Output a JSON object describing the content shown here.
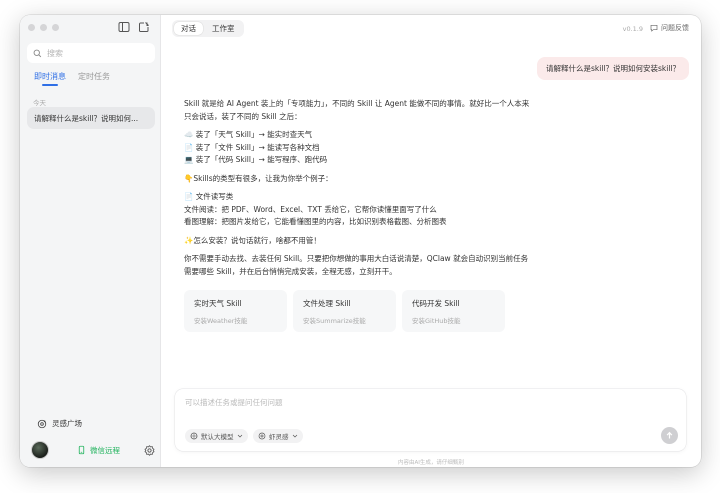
{
  "sidebar": {
    "search_placeholder": "搜索",
    "tabs": [
      "即时消息",
      "定时任务"
    ],
    "day_label": "今天",
    "conversation": "请解释什么是skill？说明如何...",
    "plaza_label": "灵感广场",
    "wechat_label": "微信远程"
  },
  "topbar": {
    "tabs": [
      "对话",
      "工作室"
    ],
    "version": "v0.1.9",
    "feedback_label": "问题反馈"
  },
  "chat": {
    "user_message": "请解释什么是skill？说明如何安装skill？",
    "answer": {
      "p1": "Skill 就是给 AI Agent 装上的「专项能力」，不同的 Skill 让 Agent 能做不同的事情。就好比一个人本来只会说话，装了不同的 Skill 之后：",
      "l1": "☁️ 装了「天气 Skill」→ 能实时查天气",
      "l2": "📄 装了「文件 Skill」→ 能读写各种文档",
      "l3": "💻 装了「代码 Skill」→ 能写程序、跑代码",
      "p2": "👇Skills的类型有很多，让我为你举个例子：",
      "p3a": "📄 文件读写类",
      "p3b": "文件阅读：把 PDF、Word、Excel、TXT 丢给它，它帮你读懂里面写了什么",
      "p3c": "看图理解：把图片发给它，它能看懂图里的内容，比如识别表格截图、分析图表",
      "p4": "✨怎么安装？说句话就行，啥都不用管！",
      "p5": "你不需要手动去找、去装任何 Skill。只要把你想做的事用大白话说清楚，QClaw 就会自动识别当前任务需要哪些 Skill，并在后台悄悄完成安装，全程无感，立刻开干。"
    },
    "cards": [
      {
        "title": "实时天气 Skill",
        "subtitle": "安装Weather技能"
      },
      {
        "title": "文件处理 Skill",
        "subtitle": "安装Summarize技能"
      },
      {
        "title": "代码开发 Skill",
        "subtitle": "安装GitHub技能"
      }
    ]
  },
  "composer": {
    "placeholder": "可以描述任务或提问任何问题",
    "model_label": "默认大模型",
    "skill_label": "虾灵感"
  },
  "disclaimer": "内容由AI生成，请仔细甄别",
  "colors": {
    "accent": "#2f6fe6",
    "user_bubble": "#fbeaea",
    "wechat": "#22b35e"
  }
}
